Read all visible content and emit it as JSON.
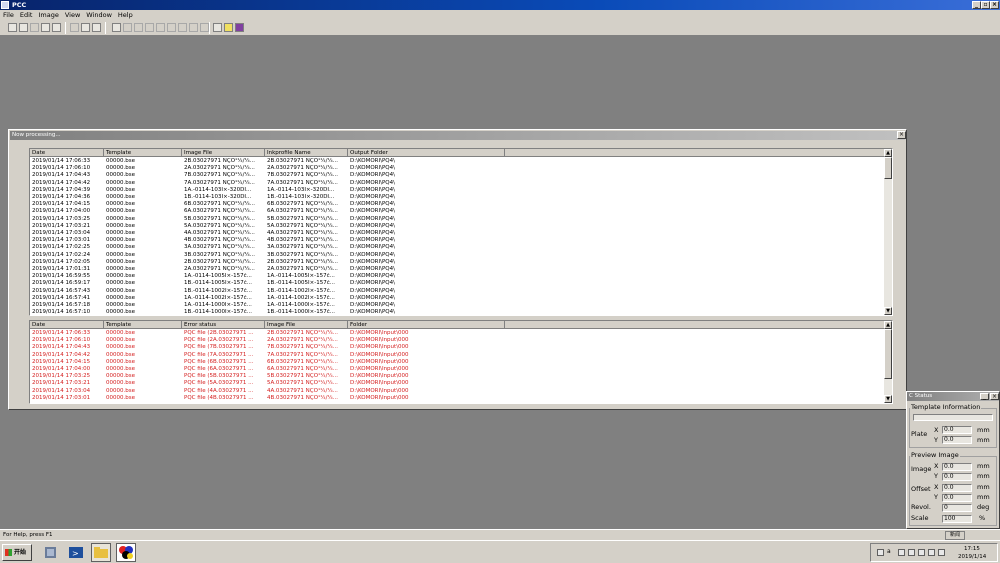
{
  "app": {
    "title": "PCC"
  },
  "menu": [
    "File",
    "Edit",
    "Image",
    "View",
    "Window",
    "Help"
  ],
  "processing": {
    "title": "Now processing...",
    "top_list": {
      "columns": [
        "Date",
        "Template",
        "Image File",
        "Inkprofile Name",
        "Output Folder"
      ],
      "rows": [
        [
          "2019/01/14 17:06:33",
          "00000.bse",
          "2B.03027971 ÑÇÕ¹¼/¼...",
          "2B.03027971 ÑÇÕ¹¼/¼...",
          "D:\\KOMORI\\PQ4\\"
        ],
        [
          "2019/01/14 17:06:10",
          "00000.bse",
          "2A.03027971 ÑÇÕ¹¼/¼...",
          "2A.03027971 ÑÇÕ¹¼/¼...",
          "D:\\KOMORI\\PQ4\\"
        ],
        [
          "2019/01/14 17:04:43",
          "00000.bse",
          "7B.03027971 ÑÇÕ¹¼/¼...",
          "7B.03027971 ÑÇÕ¹¼/¼...",
          "D:\\KOMORI\\PQ4\\"
        ],
        [
          "2019/01/14 17:04:42",
          "00000.bse",
          "7A.03027971 ÑÇÕ¹¼/¼...",
          "7A.03027971 ÑÇÕ¹¼/¼...",
          "D:\\KOMORI\\PQ4\\"
        ],
        [
          "2019/01/14 17:04:39",
          "00000.bse",
          "1A.-0114-103Ì×-320DÌ...",
          "1A.-0114-103Ì×-320DÌ...",
          "D:\\KOMORI\\PQ4\\"
        ],
        [
          "2019/01/14 17:04:36",
          "00000.bse",
          "1B.-0114-103Ì×-320DÌ...",
          "1B.-0114-103Ì×-320DÌ...",
          "D:\\KOMORI\\PQ4\\"
        ],
        [
          "2019/01/14 17:04:15",
          "00000.bse",
          "6B.03027971 ÑÇÕ¹¼/¼...",
          "6B.03027971 ÑÇÕ¹¼/¼...",
          "D:\\KOMORI\\PQ4\\"
        ],
        [
          "2019/01/14 17:04:00",
          "00000.bse",
          "6A.03027971 ÑÇÕ¹¼/¼...",
          "6A.03027971 ÑÇÕ¹¼/¼...",
          "D:\\KOMORI\\PQ4\\"
        ],
        [
          "2019/01/14 17:03:25",
          "00000.bse",
          "5B.03027971 ÑÇÕ¹¼/¼...",
          "5B.03027971 ÑÇÕ¹¼/¼...",
          "D:\\KOMORI\\PQ4\\"
        ],
        [
          "2019/01/14 17:03:21",
          "00000.bse",
          "5A.03027971 ÑÇÕ¹¼/¼...",
          "5A.03027971 ÑÇÕ¹¼/¼...",
          "D:\\KOMORI\\PQ4\\"
        ],
        [
          "2019/01/14 17:03:04",
          "00000.bse",
          "4A.03027971 ÑÇÕ¹¼/¼...",
          "4A.03027971 ÑÇÕ¹¼/¼...",
          "D:\\KOMORI\\PQ4\\"
        ],
        [
          "2019/01/14 17:03:01",
          "00000.bse",
          "4B.03027971 ÑÇÕ¹¼/¼...",
          "4B.03027971 ÑÇÕ¹¼/¼...",
          "D:\\KOMORI\\PQ4\\"
        ],
        [
          "2019/01/14 17:02:25",
          "00000.bse",
          "3A.03027971 ÑÇÕ¹¼/¼...",
          "3A.03027971 ÑÇÕ¹¼/¼...",
          "D:\\KOMORI\\PQ4\\"
        ],
        [
          "2019/01/14 17:02:24",
          "00000.bse",
          "3B.03027971 ÑÇÕ¹¼/¼...",
          "3B.03027971 ÑÇÕ¹¼/¼...",
          "D:\\KOMORI\\PQ4\\"
        ],
        [
          "2019/01/14 17:02:05",
          "00000.bse",
          "2B.03027971 ÑÇÕ¹¼/¼...",
          "2B.03027971 ÑÇÕ¹¼/¼...",
          "D:\\KOMORI\\PQ4\\"
        ],
        [
          "2019/01/14 17:01:31",
          "00000.bse",
          "2A.03027971 ÑÇÕ¹¼/¼...",
          "2A.03027971 ÑÇÕ¹¼/¼...",
          "D:\\KOMORI\\PQ4\\"
        ],
        [
          "2019/01/14 16:59:55",
          "00000.bse",
          "1A.-0114-1005Ì×-157č...",
          "1A.-0114-1005Ì×-157č...",
          "D:\\KOMORI\\PQ4\\"
        ],
        [
          "2019/01/14 16:59:17",
          "00000.bse",
          "1B.-0114-1005Ì×-157č...",
          "1B.-0114-1005Ì×-157č...",
          "D:\\KOMORI\\PQ4\\"
        ],
        [
          "2019/01/14 16:57:43",
          "00000.bse",
          "1B.-0114-1002Ì×-157č...",
          "1B.-0114-1002Ì×-157č...",
          "D:\\KOMORI\\PQ4\\"
        ],
        [
          "2019/01/14 16:57:41",
          "00000.bse",
          "1A.-0114-1002Ì×-157č...",
          "1A.-0114-1002Ì×-157č...",
          "D:\\KOMORI\\PQ4\\"
        ],
        [
          "2019/01/14 16:57:18",
          "00000.bse",
          "1A.-0114-1000Ì×-157č...",
          "1A.-0114-1000Ì×-157č...",
          "D:\\KOMORI\\PQ4\\"
        ],
        [
          "2019/01/14 16:57:10",
          "00000.bse",
          "1B.-0114-1000Ì×-157č...",
          "1B.-0114-1000Ì×-157č...",
          "D:\\KOMORI\\PQ4\\"
        ]
      ]
    },
    "error_list": {
      "columns": [
        "Date",
        "Template",
        "Error status",
        "Image File",
        "Folder"
      ],
      "rows": [
        [
          "2019/01/14 17:06:33",
          "00000.bse",
          "PQC file (2B.03027971 ...",
          "2B.03027971 ÑÇÕ¹¼/¼...",
          "D:\\KOMORI\\Input\\000"
        ],
        [
          "2019/01/14 17:06:10",
          "00000.bse",
          "PQC file (2A.03027971 ...",
          "2A.03027971 ÑÇÕ¹¼/¼...",
          "D:\\KOMORI\\Input\\000"
        ],
        [
          "2019/01/14 17:04:43",
          "00000.bse",
          "PQC file (7B.03027971 ...",
          "7B.03027971 ÑÇÕ¹¼/¼...",
          "D:\\KOMORI\\Input\\000"
        ],
        [
          "2019/01/14 17:04:42",
          "00000.bse",
          "PQC file (7A.03027971 ...",
          "7A.03027971 ÑÇÕ¹¼/¼...",
          "D:\\KOMORI\\Input\\000"
        ],
        [
          "2019/01/14 17:04:15",
          "00000.bse",
          "PQC file (6B.03027971 ...",
          "6B.03027971 ÑÇÕ¹¼/¼...",
          "D:\\KOMORI\\Input\\000"
        ],
        [
          "2019/01/14 17:04:00",
          "00000.bse",
          "PQC file (6A.03027971 ...",
          "6A.03027971 ÑÇÕ¹¼/¼...",
          "D:\\KOMORI\\Input\\000"
        ],
        [
          "2019/01/14 17:03:25",
          "00000.bse",
          "PQC file (5B.03027971 ...",
          "5B.03027971 ÑÇÕ¹¼/¼...",
          "D:\\KOMORI\\Input\\000"
        ],
        [
          "2019/01/14 17:03:21",
          "00000.bse",
          "PQC file (5A.03027971 ...",
          "5A.03027971 ÑÇÕ¹¼/¼...",
          "D:\\KOMORI\\Input\\000"
        ],
        [
          "2019/01/14 17:03:04",
          "00000.bse",
          "PQC file (4A.03027971 ...",
          "4A.03027971 ÑÇÕ¹¼/¼...",
          "D:\\KOMORI\\Input\\000"
        ],
        [
          "2019/01/14 17:03:01",
          "00000.bse",
          "PQC file (4B.03027971 ...",
          "4B.03027971 ÑÇÕ¹¼/¼...",
          "D:\\KOMORI\\Input\\000"
        ]
      ]
    }
  },
  "status_panel": {
    "title": "C Status",
    "template_info": "Template Information",
    "plate": "Plate",
    "x": "X",
    "y": "Y",
    "plate_x": "0.0",
    "plate_y": "0.0",
    "unit_mm": "mm",
    "preview": "Preview Image",
    "image": "Image",
    "image_x": "0.0",
    "image_y": "0.0",
    "offset": "Offset",
    "offset_x": "0.0",
    "offset_y": "0.0",
    "revol": "Revol.",
    "revol_value": "0",
    "unit_deg": "deg",
    "scale": "Scale",
    "scale_value": "100",
    "unit_pct": "%",
    "tab_label": "新闻"
  },
  "statusbar": {
    "help": "For Help, press F1"
  },
  "taskbar": {
    "start": "开始",
    "time": "17:15",
    "date": "2019/1/14",
    "tray_label": "a"
  },
  "icons": {
    "app": "pcc-app-icon",
    "minimize": "minimize-icon",
    "restore": "restore-icon",
    "close": "close-icon"
  }
}
